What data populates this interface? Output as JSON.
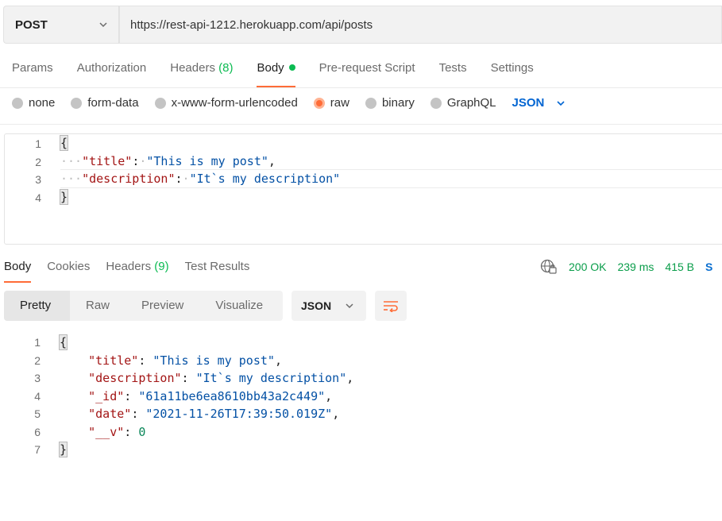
{
  "request": {
    "method": "POST",
    "url": "https://rest-api-1212.herokuapp.com/api/posts"
  },
  "request_tabs": [
    {
      "label": "Params"
    },
    {
      "label": "Authorization"
    },
    {
      "label": "Headers",
      "count": "(8)"
    },
    {
      "label": "Body"
    },
    {
      "label": "Pre-request Script"
    },
    {
      "label": "Tests"
    },
    {
      "label": "Settings"
    }
  ],
  "body_types": [
    "none",
    "form-data",
    "x-www-form-urlencoded",
    "raw",
    "binary",
    "GraphQL"
  ],
  "body_format": "JSON",
  "request_body": {
    "line_numbers": [
      "1",
      "2",
      "3",
      "4"
    ],
    "open": "{",
    "close": "}",
    "k1": "\"title\"",
    "v1": "\"This is my post\"",
    "k2": "\"description\"",
    "v2": "\"It`s my description\""
  },
  "response_tabs": [
    {
      "label": "Body"
    },
    {
      "label": "Cookies"
    },
    {
      "label": "Headers",
      "count": "(9)"
    },
    {
      "label": "Test Results"
    }
  ],
  "status": {
    "code": "200 OK",
    "time": "239 ms",
    "size": "415 B",
    "trunc": "S"
  },
  "view_tabs": [
    "Pretty",
    "Raw",
    "Preview",
    "Visualize"
  ],
  "response_format": "JSON",
  "response_body": {
    "line_numbers": [
      "1",
      "2",
      "3",
      "4",
      "5",
      "6",
      "7"
    ],
    "open": "{",
    "close": "}",
    "k1": "\"title\"",
    "v1": "\"This is my post\"",
    "k2": "\"description\"",
    "v2": "\"It`s my description\"",
    "k3": "\"_id\"",
    "v3": "\"61a11be6ea8610bb43a2c449\"",
    "k4": "\"date\"",
    "v4": "\"2021-11-26T17:39:50.019Z\"",
    "k5": "\"__v\"",
    "v5": "0"
  },
  "colors": {
    "accent": "#ff6c37",
    "success": "#0cbb52",
    "link": "#0265d2"
  }
}
